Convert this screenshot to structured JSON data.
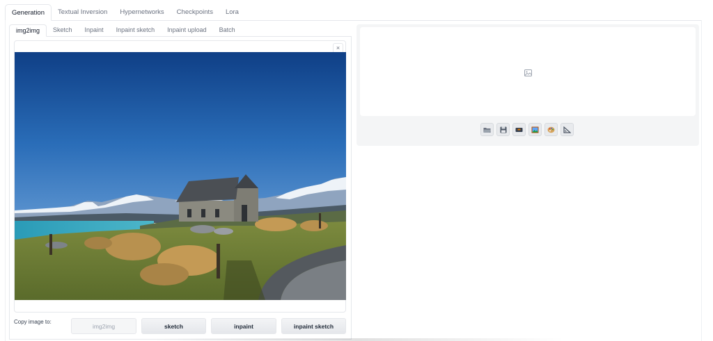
{
  "top_tabs": [
    {
      "label": "Generation",
      "active": true
    },
    {
      "label": "Textual Inversion",
      "active": false
    },
    {
      "label": "Hypernetworks",
      "active": false
    },
    {
      "label": "Checkpoints",
      "active": false
    },
    {
      "label": "Lora",
      "active": false
    }
  ],
  "sub_tabs": [
    {
      "label": "img2img",
      "active": true
    },
    {
      "label": "Sketch",
      "active": false
    },
    {
      "label": "Inpaint",
      "active": false
    },
    {
      "label": "Inpaint sketch",
      "active": false
    },
    {
      "label": "Inpaint upload",
      "active": false
    },
    {
      "label": "Batch",
      "active": false
    }
  ],
  "input_image": {
    "close_symbol": "×",
    "icon": "close-icon"
  },
  "copy_section": {
    "label": "Copy image to:",
    "buttons": [
      {
        "label": "img2img",
        "disabled": true
      },
      {
        "label": "sketch",
        "disabled": false
      },
      {
        "label": "inpaint",
        "disabled": false
      },
      {
        "label": "inpaint sketch",
        "disabled": false
      }
    ]
  },
  "output": {
    "placeholder_icon": "image-icon",
    "toolbar": [
      {
        "icon": "folder-icon"
      },
      {
        "icon": "save-icon"
      },
      {
        "icon": "zip-icon"
      },
      {
        "icon": "picture-icon"
      },
      {
        "icon": "palette-icon"
      },
      {
        "icon": "ruler-triangle-icon"
      }
    ]
  },
  "colors": {
    "accent_border": "#e5e7eb",
    "button_bg": "#e5e7eb",
    "panel_bg": "#f4f5f6"
  }
}
